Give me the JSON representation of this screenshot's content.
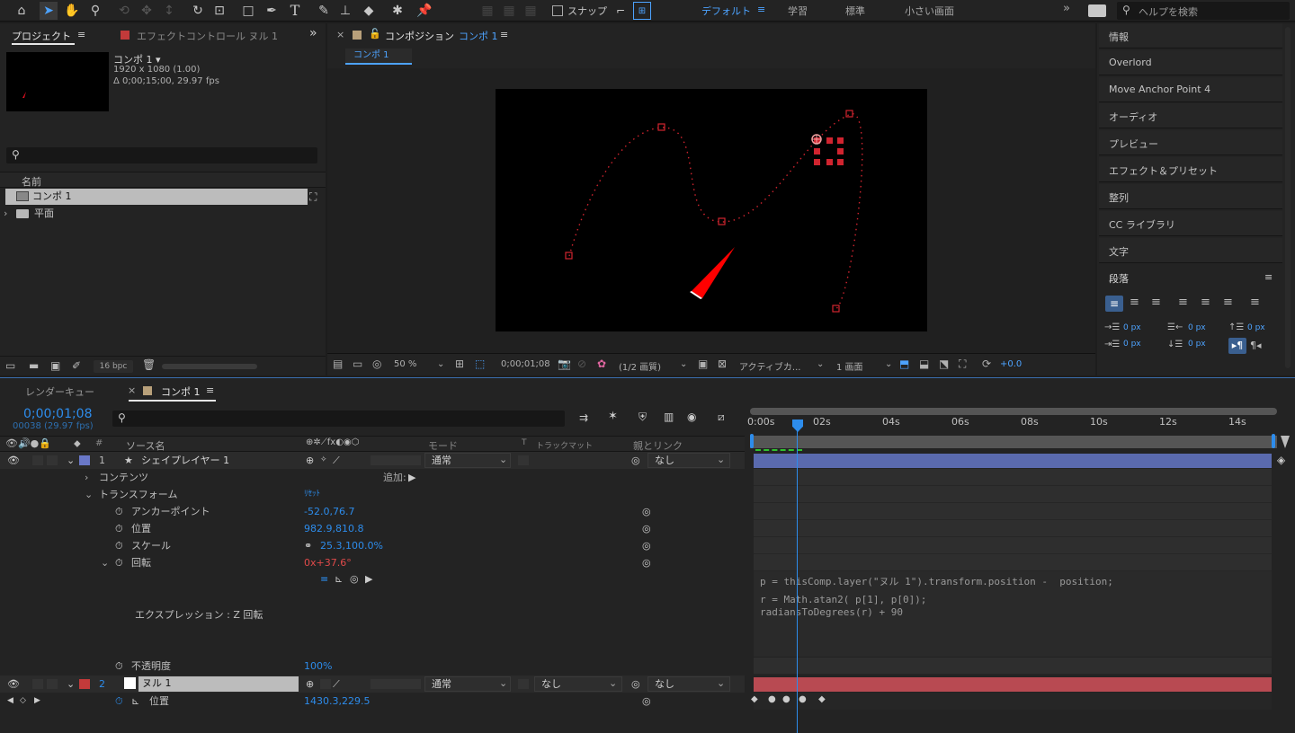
{
  "toolbar": {
    "snap_label": "スナップ",
    "workspaces": [
      "デフォルト",
      "学習",
      "標準",
      "小さい画面"
    ],
    "search_placeholder": "ヘルプを検索"
  },
  "project": {
    "tabs": [
      "プロジェクト",
      "エフェクトコントロール ヌル 1"
    ],
    "comp_name": "コンポ 1 ▾",
    "comp_res": "1920 x 1080 (1.00)",
    "comp_dur": "Δ 0;00;15;00, 29.97 fps",
    "col_name": "名前",
    "items": [
      "コンポ 1",
      "平面"
    ],
    "bpc": "16 bpc"
  },
  "viewer": {
    "title": "コンポジション",
    "title_comp": "コンポ 1",
    "subtab": "コンポ 1",
    "zoom": "50 %",
    "time": "0;00;01;08",
    "quality": "(1/2 画質)",
    "camera": "アクティブカ...",
    "views": "1 画面",
    "exposure": "+0.0"
  },
  "right_panels": [
    "情報",
    "Overlord",
    "Move Anchor Point 4",
    "オーディオ",
    "プレビュー",
    "エフェクト＆プリセット",
    "整列",
    "CC ライブラリ",
    "文字"
  ],
  "paragraph": {
    "title": "段落",
    "values": [
      "0 px",
      "0 px",
      "0 px",
      "0 px",
      "0 px"
    ]
  },
  "timeline": {
    "tabs": [
      "レンダーキュー",
      "コンポ 1"
    ],
    "timecode": "0;00;01;08",
    "frames": "00038 (29.97 fps)",
    "headers": {
      "source": "ソース名",
      "mode": "モード",
      "t": "T",
      "trkmat": "トラックマット",
      "parent": "親とリンク"
    },
    "ruler": [
      "0:00s",
      "02s",
      "04s",
      "06s",
      "08s",
      "10s",
      "12s",
      "14s"
    ],
    "layer1": {
      "num": "1",
      "name": "シェイプレイヤー 1",
      "mode": "通常",
      "parent": "なし"
    },
    "contents": "コンテンツ",
    "add_label": "追加:",
    "transform": "トランスフォーム",
    "reset": "ﾘｾｯﾄ",
    "props": [
      {
        "name": "アンカーポイント",
        "value": "-52.0,76.7"
      },
      {
        "name": "位置",
        "value": "982.9,810.8"
      },
      {
        "name": "スケール",
        "value": "25.3,100.0%"
      },
      {
        "name": "回転",
        "value": "0x+37.6°"
      }
    ],
    "expr_label": "エクスプレッション : Z 回転",
    "opacity": {
      "name": "不透明度",
      "value": "100%"
    },
    "layer2": {
      "num": "2",
      "name": "ヌル 1",
      "mode": "通常",
      "trkmat": "なし",
      "parent": "なし"
    },
    "pos2": {
      "name": "位置",
      "value": "1430.3,229.5"
    },
    "expression": [
      "p = thisComp.layer(\"ヌル 1\").transform.position -  position;",
      "r = Math.atan2( p[1], p[0]);",
      "radiansToDegrees(r) + 90"
    ]
  },
  "colors": {
    "accent": "#2d8ceb",
    "layer1": "#6a78c8",
    "layer2": "#c23a3a",
    "path": "#d0242f"
  }
}
